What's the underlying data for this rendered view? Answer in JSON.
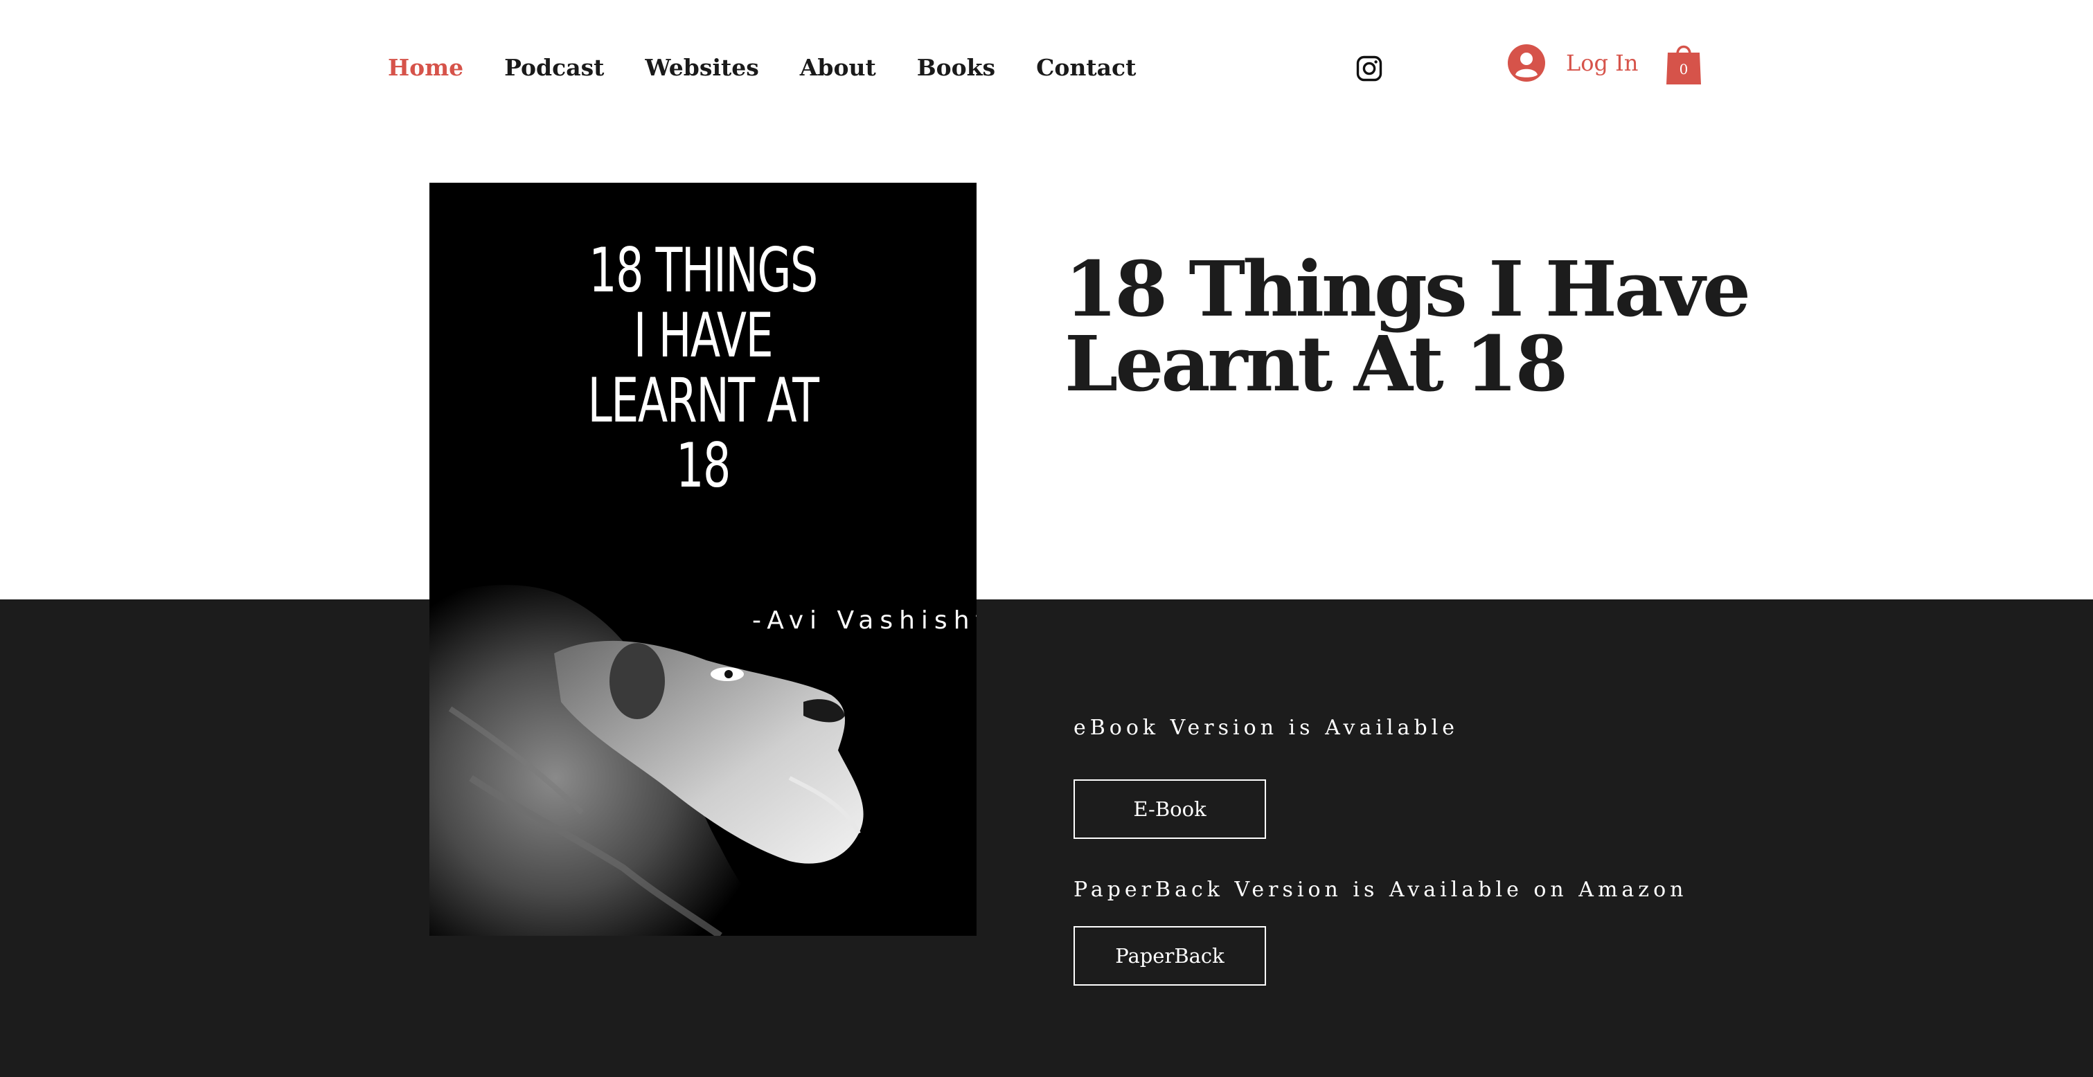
{
  "nav": {
    "items": [
      {
        "label": "Home",
        "active": true
      },
      {
        "label": "Podcast",
        "active": false
      },
      {
        "label": "Websites",
        "active": false
      },
      {
        "label": "About",
        "active": false
      },
      {
        "label": "Books",
        "active": false
      },
      {
        "label": "Contact",
        "active": false
      }
    ]
  },
  "header": {
    "social_icon": "instagram-icon",
    "login_label": "Log In",
    "cart_count": "0"
  },
  "book": {
    "cover_title_lines": [
      "18 THINGS",
      "I HAVE",
      "LEARNT AT",
      "18"
    ],
    "cover_author": "-Avi Vashishta",
    "title_lines": [
      "18 Things I Have",
      "Learnt At 18"
    ]
  },
  "purchase": {
    "ebook_text": "eBook Version is Available",
    "ebook_button": "E-Book",
    "paperback_text": "PaperBack Version is Available on Amazon",
    "paperback_button": "PaperBack"
  },
  "colors": {
    "accent": "#d6534a",
    "text_dark": "#1c1c1c",
    "band": "#1c1c1c"
  }
}
